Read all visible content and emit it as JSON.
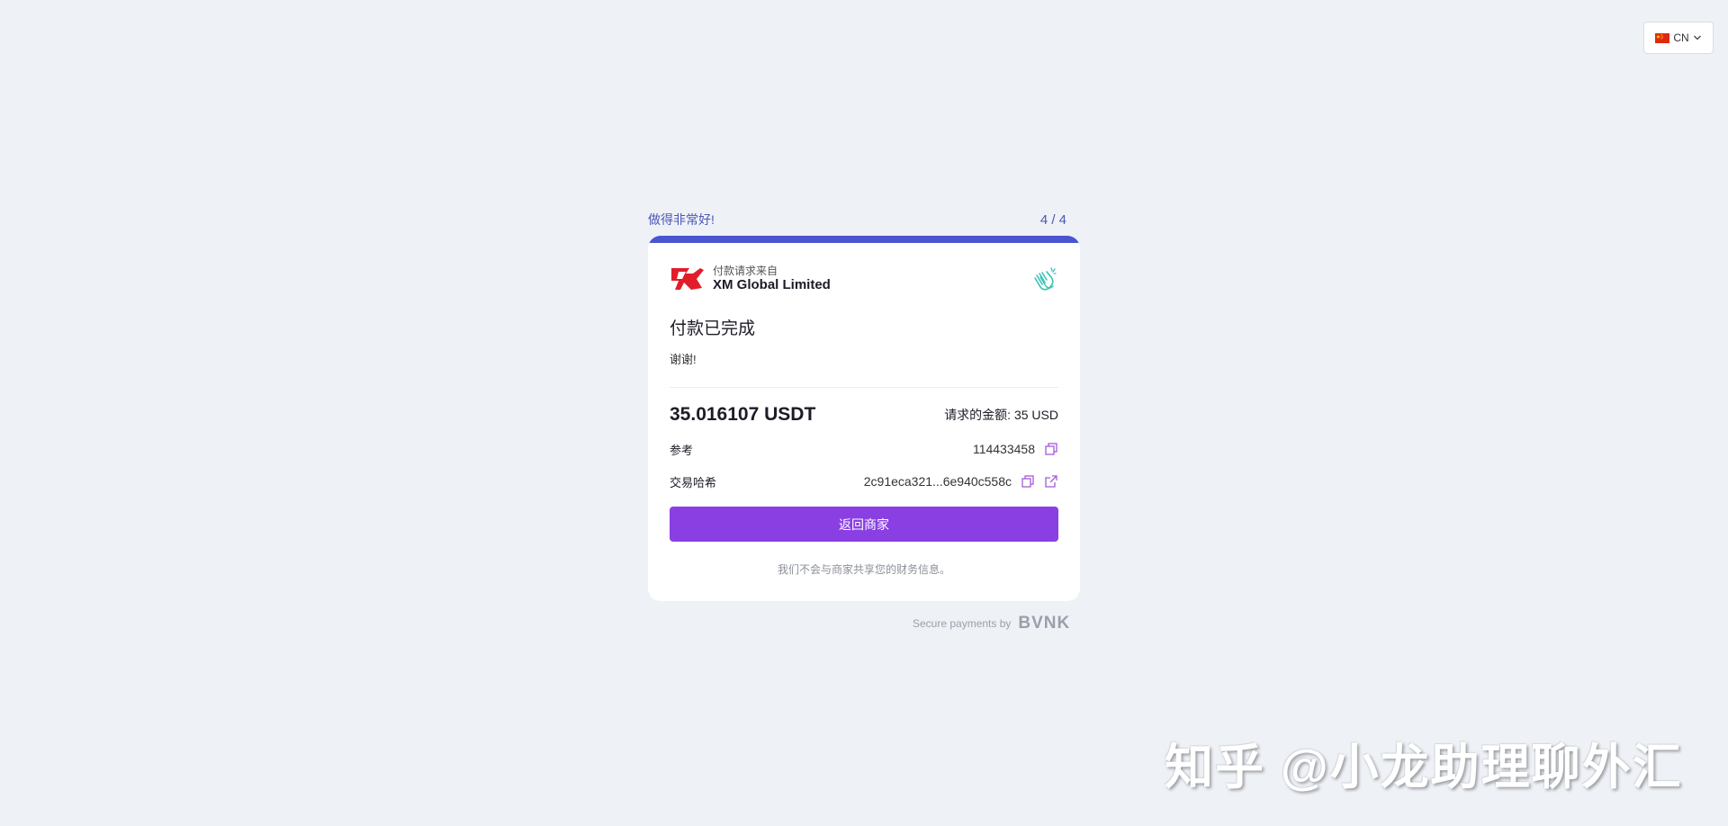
{
  "language": {
    "code": "CN",
    "flag": "china-flag-icon"
  },
  "step": {
    "message": "做得非常好!",
    "count": "4 / 4",
    "progress": 1.0
  },
  "merchant": {
    "label": "付款请求来自",
    "name": "XM Global Limited",
    "logo": "xm-logo-icon"
  },
  "status": {
    "title": "付款已完成",
    "subtitle": "谢谢!"
  },
  "payment": {
    "amount": "35.016107 USDT",
    "requested_label": "请求的金额:",
    "requested_value": "35 USD"
  },
  "reference": {
    "label": "参考",
    "value": "114433458"
  },
  "transaction": {
    "label": "交易哈希",
    "value": "2c91eca321...6e940c558c"
  },
  "actions": {
    "return_label": "返回商家"
  },
  "privacy_note": "我们不会与商家共享您的财务信息。",
  "footer": {
    "secure_text": "Secure payments by",
    "brand": "BVNK"
  },
  "watermark": "知乎 @小龙助理聊外汇",
  "colors": {
    "accent": "#8a3fe3",
    "progress": "#4a55cf",
    "background": "#eef1f6"
  }
}
